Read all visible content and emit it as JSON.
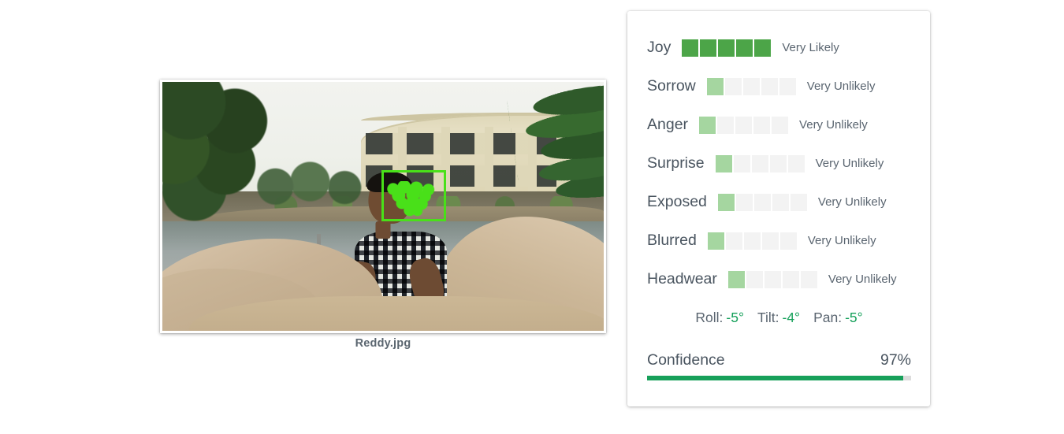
{
  "photo": {
    "caption": "Reddy.jpg",
    "alt_description": "Person in checkered shirt seated on sandstone rocks beside a pond with a curved two-story building behind",
    "face_detection": {
      "box_color": "#49e019",
      "landmark_color": "#49e019"
    }
  },
  "results": {
    "likelihoods": [
      {
        "label": "Joy",
        "status": "Very Likely",
        "filled": 5
      },
      {
        "label": "Sorrow",
        "status": "Very Unlikely",
        "filled": 1
      },
      {
        "label": "Anger",
        "status": "Very Unlikely",
        "filled": 1
      },
      {
        "label": "Surprise",
        "status": "Very Unlikely",
        "filled": 1
      },
      {
        "label": "Exposed",
        "status": "Very Unlikely",
        "filled": 1
      },
      {
        "label": "Blurred",
        "status": "Very Unlikely",
        "filled": 1
      },
      {
        "label": "Headwear",
        "status": "Very Unlikely",
        "filled": 1
      }
    ],
    "pose": [
      {
        "label": "Roll:",
        "value": "-5°"
      },
      {
        "label": "Tilt:",
        "value": "-4°"
      },
      {
        "label": "Pan:",
        "value": "-5°"
      }
    ],
    "confidence": {
      "label": "Confidence",
      "value_text": "97%",
      "percent": 97
    }
  },
  "colors": {
    "segment_high": "#4ca548",
    "segment_low": "#a5d6a0",
    "segment_empty": "#f3f3f3",
    "confidence_fill": "#17a05a",
    "pose_value": "#15a05a",
    "label_text": "#4a5560",
    "status_text": "#5a6570"
  }
}
